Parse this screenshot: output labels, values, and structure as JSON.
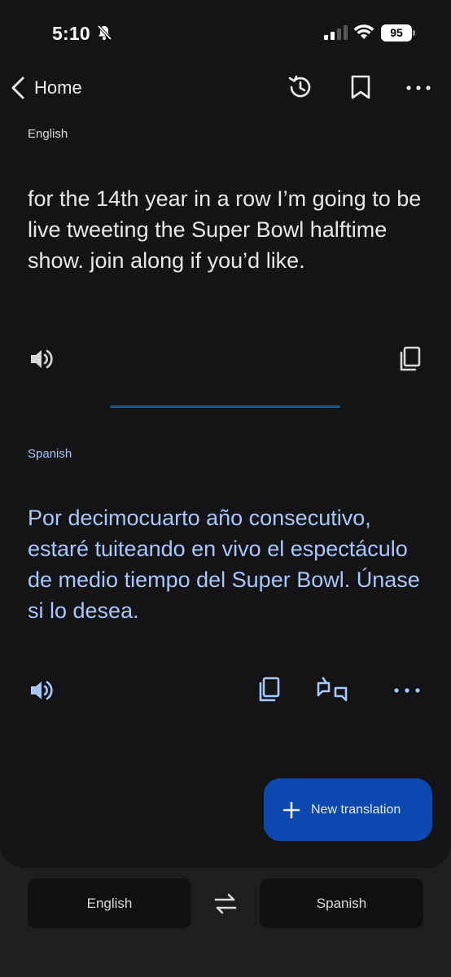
{
  "status_bar": {
    "time": "5:10",
    "battery": "95"
  },
  "nav": {
    "back_label": "Home"
  },
  "source": {
    "language": "English",
    "text": "for the 14th year in a row I’m going to be live tweeting the Super Bowl halftime show. join along if you’d like."
  },
  "target": {
    "language": "Spanish",
    "text": "Por decimocuarto año consecutivo, estaré tuiteando en vivo el espectáculo de medio tiempo del Super Bowl. Únase si lo desea."
  },
  "fab": {
    "label": "New translation"
  },
  "language_bar": {
    "source": "English",
    "target": "Spanish"
  },
  "colors": {
    "background": "#141416",
    "accent_text": "#a8c7fa",
    "fab": "#0b48b0",
    "divider": "#1a5484"
  }
}
